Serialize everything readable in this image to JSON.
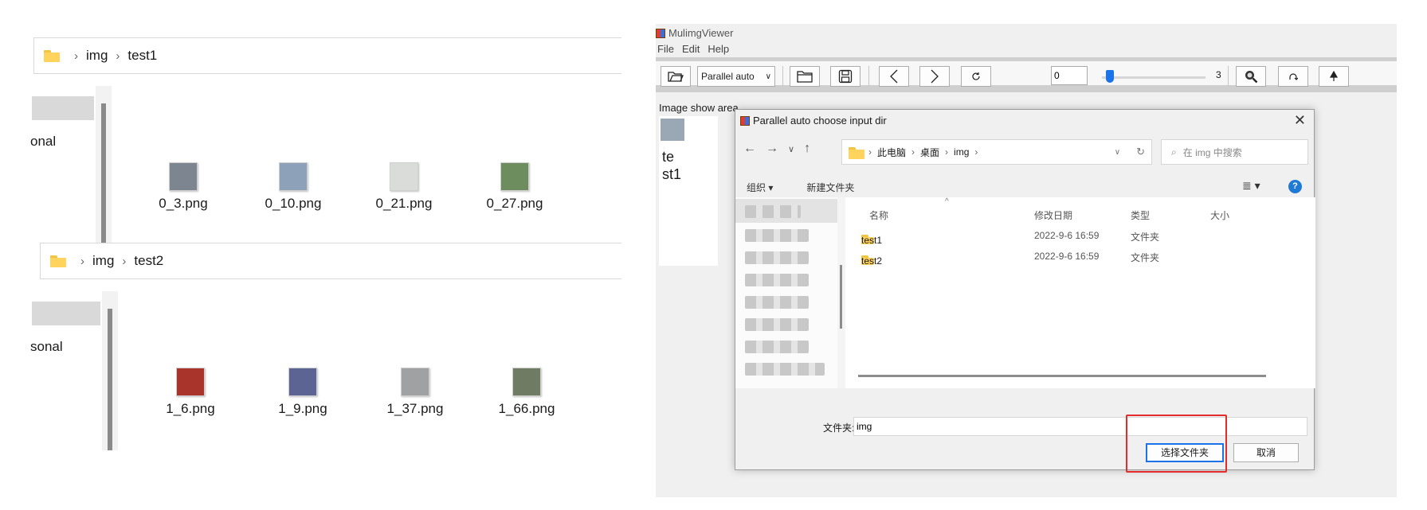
{
  "explorer_panels": [
    {
      "breadcrumb": [
        "img",
        "test1"
      ],
      "nav_label": "onal",
      "files": [
        {
          "name": "0_3.png",
          "thumb": "#7d8590"
        },
        {
          "name": "0_10.png",
          "thumb": "#8da1b8"
        },
        {
          "name": "0_21.png",
          "thumb": "#d9dcd8"
        },
        {
          "name": "0_27.png",
          "thumb": "#6e8d5f"
        }
      ]
    },
    {
      "breadcrumb": [
        "img",
        "test2"
      ],
      "nav_label": "sonal",
      "files": [
        {
          "name": "1_6.png",
          "thumb": "#a8342c"
        },
        {
          "name": "1_9.png",
          "thumb": "#5b6492"
        },
        {
          "name": "1_37.png",
          "thumb": "#9fa1a2"
        },
        {
          "name": "1_66.png",
          "thumb": "#6f7b62"
        }
      ]
    }
  ],
  "app": {
    "title": "MulimgViewer",
    "menu": [
      "File",
      "Edit",
      "Help"
    ],
    "toolbar": {
      "mode_select": "Parallel auto",
      "index_value": "0",
      "slider_max": "3",
      "slider_fraction": 0.0
    },
    "show_area_label": "Image show area",
    "show_text": [
      "te",
      "st1"
    ]
  },
  "dialog": {
    "title": "Parallel auto choose input dir",
    "close_glyph": "✕",
    "address": [
      "此电脑",
      "桌面",
      "img"
    ],
    "search_placeholder": "在 img 中搜索",
    "commands": [
      "组织 ▾",
      "新建文件夹"
    ],
    "columns": [
      "名称",
      "修改日期",
      "类型",
      "大小"
    ],
    "rows": [
      {
        "name": "test1",
        "date": "2022-9-6 16:59",
        "type": "文件夹"
      },
      {
        "name": "test2",
        "date": "2022-9-6 16:59",
        "type": "文件夹"
      }
    ],
    "folder_label": "文件夹:",
    "folder_value": "img",
    "select_button": "选择文件夹",
    "cancel_button": "取消",
    "help_glyph": "?",
    "view_glyph": "≣ ▾"
  },
  "colors": {
    "accent": "#1a73e8",
    "annotation": "#e52b2b",
    "folder": "#ffd35c"
  }
}
